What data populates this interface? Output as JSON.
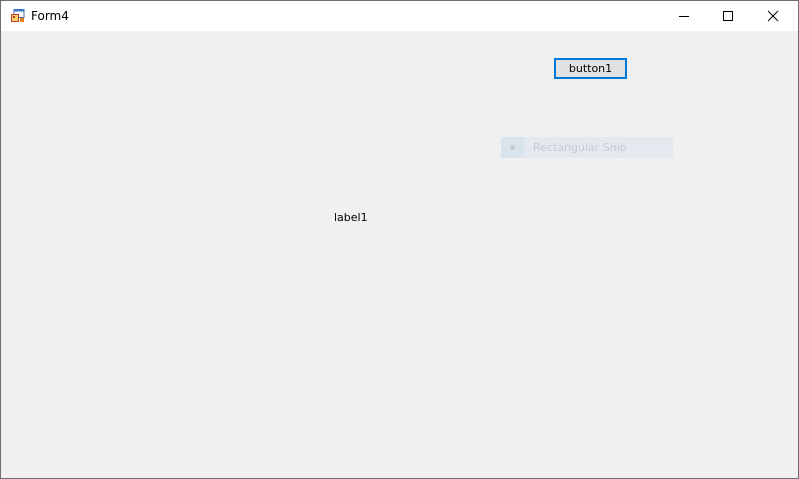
{
  "window": {
    "title": "Form4",
    "icon": "winforms-app-icon",
    "controls": {
      "minimize_icon": "minimize-icon",
      "maximize_icon": "maximize-icon",
      "close_icon": "close-icon"
    }
  },
  "form": {
    "button1_label": "button1",
    "label1_text": "label1"
  },
  "snip_overlay": {
    "icon": "radio-dot-icon",
    "label": "Rectangular Snip"
  },
  "colors": {
    "focus_border": "#0078d7",
    "form_background": "#f0f0f0",
    "titlebar_background": "#ffffff"
  }
}
